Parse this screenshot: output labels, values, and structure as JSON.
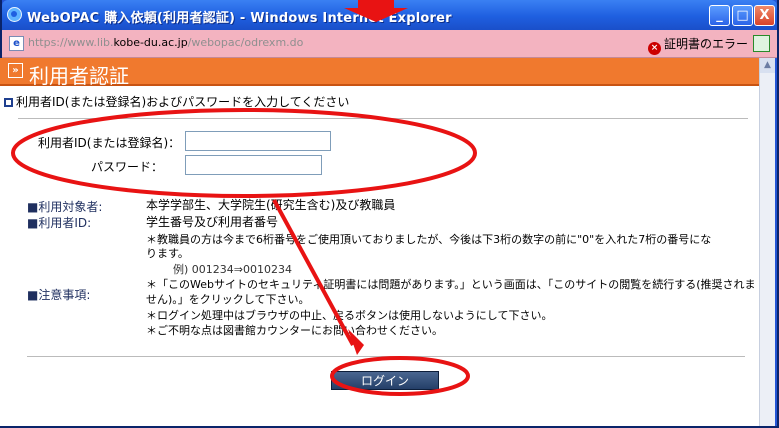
{
  "window": {
    "title": "WebOPAC 購入依頼(利用者認証) - Windows Internet Explorer",
    "buttons": {
      "minimize": "_",
      "maximize": "□",
      "close": "X"
    }
  },
  "address_bar": {
    "url_prefix": "https://www.lib.",
    "url_domain": "kobe-du.ac.jp",
    "url_path": "/webopac/odrexm.do",
    "cert_error": "証明書のエラー"
  },
  "page": {
    "title": "利用者認証",
    "instruction": "利用者ID(または登録名)およびパスワードを入力してください"
  },
  "form": {
    "user_id_label": "利用者ID(または登録名)：",
    "user_id_value": "",
    "password_label": "パスワード：",
    "password_value": ""
  },
  "notes": {
    "target_label": "■利用対象者:",
    "target_text": "本学学部生、大学院生(研究生含む)及び教職員",
    "userid_label": "■利用者ID:",
    "userid_text": "学生番号及び利用者番号",
    "staff_note_1": "＊教職員の方は今まで6桁番号をご使用頂いておりましたが、今後は下3桁の数字の前に\"0\"を入れた7桁の番号にな",
    "staff_note_2": "ります。",
    "example": "例) 001234⇒0010234",
    "caution_label": "■注意事項:",
    "caution_1a": "＊「このWebサイトのセキュリティ証明書には問題があります。」という画面は、「このサイトの閲覧を続行する(推奨されま",
    "caution_1b": "せん)。」をクリックして下さい。",
    "caution_2": "＊ログイン処理中はブラウザの中止、戻るボタンは使用しないようにして下さい。",
    "caution_3": "＊ご不明な点は図書館カウンターにお問い合わせください。"
  },
  "login_button": "ログイン",
  "colors": {
    "titlebar": "#2456d6",
    "address_error": "#f3b3c0",
    "page_header": "#f0792e",
    "annotation": "#e81313"
  }
}
